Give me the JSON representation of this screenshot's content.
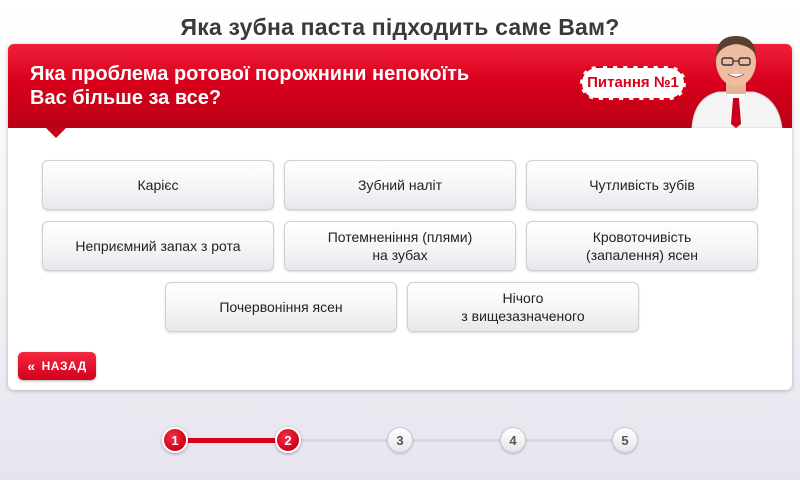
{
  "page": {
    "title": "Яка зубна паста підходить саме Вам?"
  },
  "question": {
    "lines": [
      "Яка проблема ротової порожнини непокоїть",
      "Вас більше за все?"
    ],
    "badge": "Питання №1"
  },
  "options": [
    "Карієс",
    "Зубний наліт",
    "Чутливість зубів",
    "Неприємний запах з рота",
    "Потемненіння (плями)\nна зубах",
    "Кровоточивість\n(запалення) ясен",
    "Почервоніння ясен",
    "Нічого\nз вищезазначеного"
  ],
  "back_button": {
    "label": "НАЗАД",
    "icon": "double-chevron-left-icon"
  },
  "progress": {
    "steps": [
      "1",
      "2",
      "3",
      "4",
      "5"
    ],
    "active_through": 2
  },
  "colors": {
    "accent": "#d9001c",
    "title": "#3a3a3a",
    "track": "#d7d7dc"
  }
}
